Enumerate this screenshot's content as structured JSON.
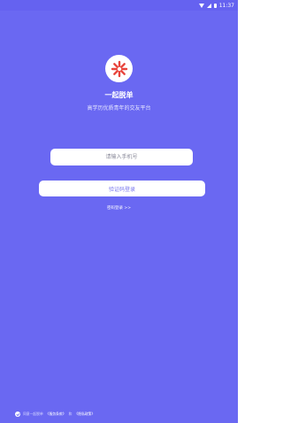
{
  "status_bar": {
    "time": "11:37",
    "icons": [
      "wifi-icon",
      "signal-icon",
      "battery-icon"
    ]
  },
  "brand": {
    "app_name": "一起脱单",
    "tagline": "高学历优质青年的交友平台",
    "logo_icon": "asterisk-flower-icon",
    "logo_color": "#e8453c"
  },
  "form": {
    "phone_placeholder": "请输入手机号",
    "login_button": "验证码登录",
    "password_link": "密码登录 >>"
  },
  "agreement": {
    "prefix": "同意一起脱单",
    "user_agreement": "《服务条款》",
    "separator": "和",
    "privacy_policy": "《隐私政策》"
  },
  "colors": {
    "background": "#6a68f2",
    "button_text": "#7a78ee"
  }
}
